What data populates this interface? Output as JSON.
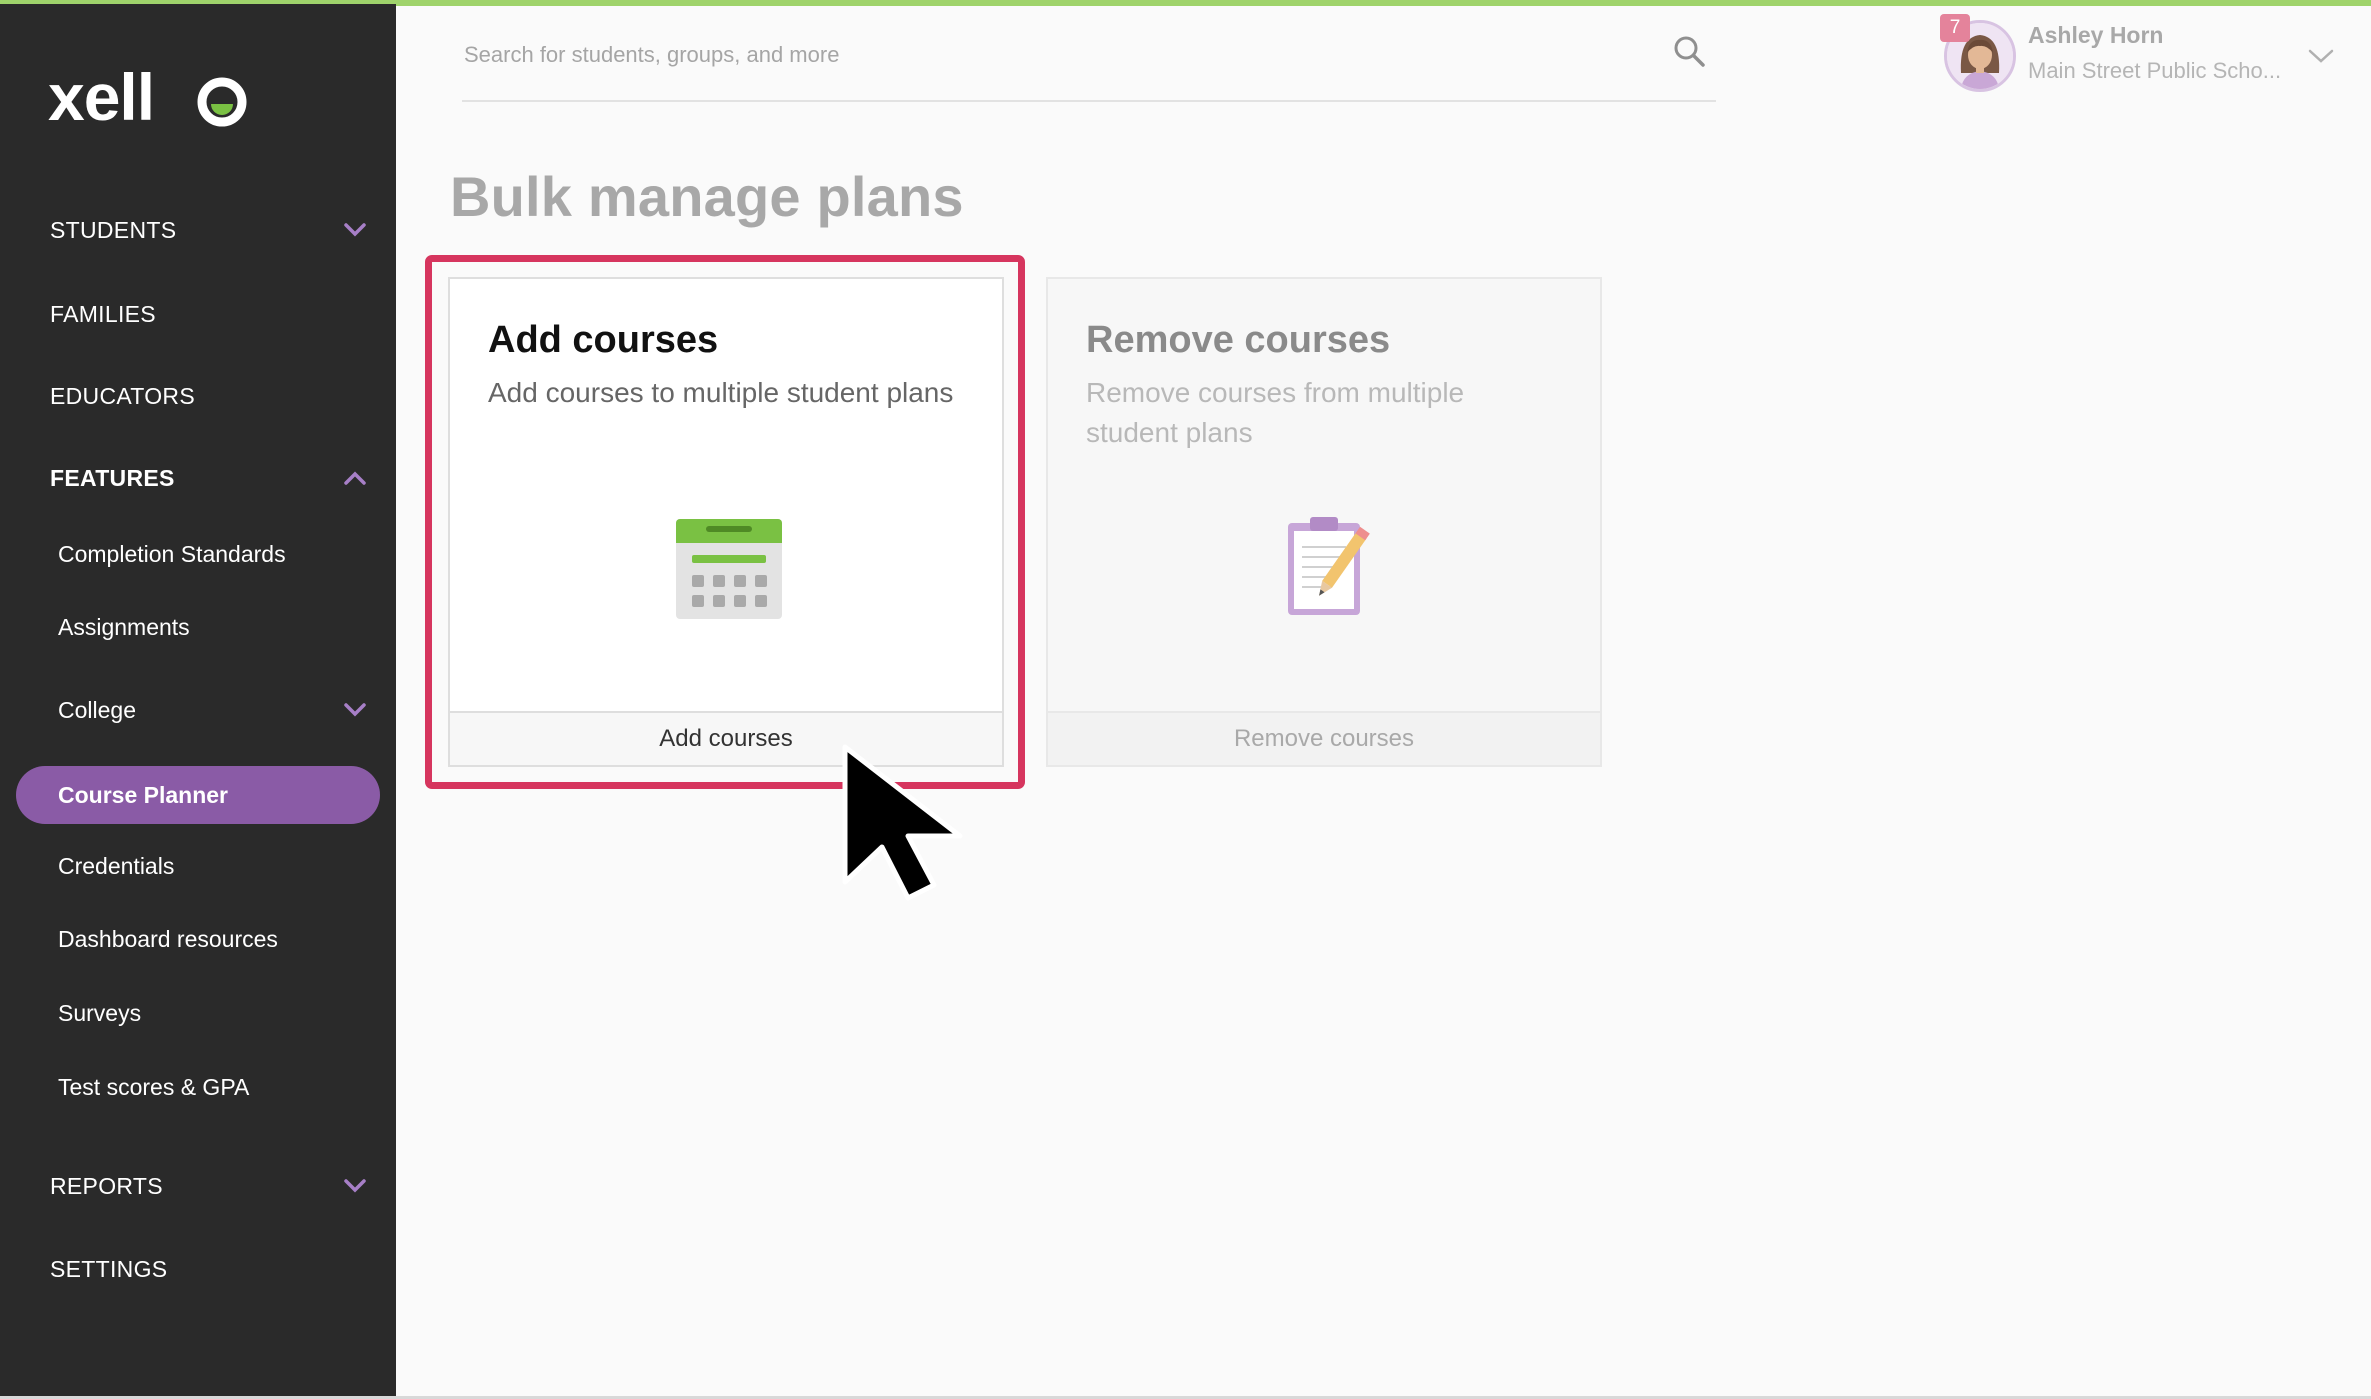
{
  "app": {
    "logo_text": "xello"
  },
  "header": {
    "search_placeholder": "Search for students, groups, and more",
    "user": {
      "name": "Ashley Horn",
      "school": "Main Street Public Scho...",
      "notification_count": "7"
    }
  },
  "sidebar": {
    "students": "STUDENTS",
    "families": "FAMILIES",
    "educators": "EDUCATORS",
    "features": "FEATURES",
    "features_items": {
      "completion_standards": "Completion Standards",
      "assignments": "Assignments",
      "college": "College",
      "course_planner": "Course Planner",
      "credentials": "Credentials",
      "dashboard_resources": "Dashboard resources",
      "surveys": "Surveys",
      "test_scores": "Test scores & GPA"
    },
    "reports": "REPORTS",
    "settings": "SETTINGS"
  },
  "main": {
    "title": "Bulk manage plans",
    "cards": [
      {
        "title": "Add courses",
        "description": "Add courses to multiple student plans",
        "action": "Add courses",
        "icon": "calendar-icon"
      },
      {
        "title": "Remove courses",
        "description": "Remove courses from multiple student plans",
        "action": "Remove courses",
        "icon": "clipboard-pencil-icon"
      }
    ]
  },
  "colors": {
    "sidebar_bg": "#2a2a2a",
    "accent_purple": "#8a5ba6",
    "highlight_red": "#d6355e",
    "accent_green": "#7ac143"
  }
}
